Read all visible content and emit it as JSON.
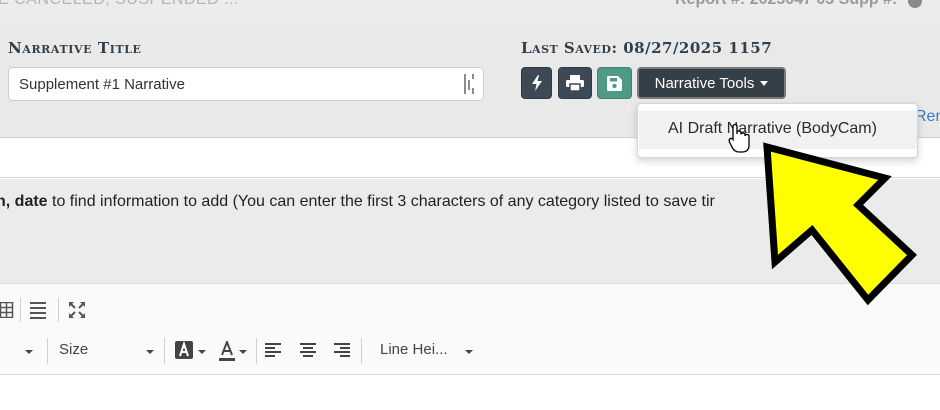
{
  "header": {
    "status_text": "E CANCELED, SUSPENDED ...",
    "report_text": "Report #: 2025047 03 Supp #:"
  },
  "narrative": {
    "title_label": "Narrative Title",
    "title_value": "Supplement #1 Narrative",
    "last_saved_label": "Last Saved: 08/27/2025 1157"
  },
  "buttons": {
    "tools_label": "Narrative Tools",
    "rem_link": "Rem"
  },
  "dropdown": {
    "items": [
      "AI Draft Narrative (BodyCam)"
    ]
  },
  "instruction": {
    "bold_part": "n, date",
    "rest": " to find information to add (You can enter the first 3 characters of any category listed to save tir"
  },
  "toolbar": {
    "size_label": "Size",
    "line_height_label": "Line Hei..."
  },
  "icons": [
    "bolt-icon",
    "print-icon",
    "save-icon",
    "grip-icon",
    "table-icon",
    "align-icon",
    "fullscreen-icon",
    "highlight-color-icon",
    "text-color-icon",
    "align-left-icon",
    "align-center-icon",
    "align-right-icon",
    "info-icon",
    "pointer-cursor-icon"
  ],
  "colors": {
    "panel_bg": "#e9e9e9",
    "dark_button": "#3d4a55",
    "save_button": "#4f9a84",
    "tools_button": "#343f48",
    "annotation_arrow": "#ffff00",
    "link": "#3a7cc4"
  }
}
